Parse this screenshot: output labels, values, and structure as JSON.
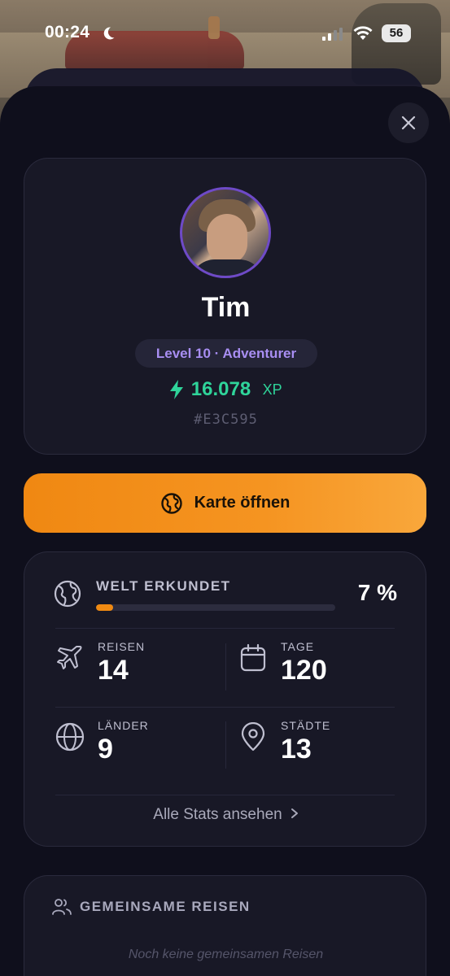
{
  "status_bar": {
    "time": "00:24",
    "battery": "56",
    "icons": [
      "moon-icon",
      "signal-icon",
      "wifi-icon",
      "battery-icon"
    ]
  },
  "profile": {
    "name": "Tim",
    "level_badge": "Level 10 · Adventurer",
    "xp_value": "16.078",
    "xp_unit": "XP",
    "code": "#E3C595"
  },
  "map_button": {
    "label": "Karte öffnen",
    "icon": "globe-icon"
  },
  "world_explored": {
    "label": "WELT ERKUNDET",
    "percent_text": "7 %",
    "progress": 0.07
  },
  "stats": [
    {
      "label": "REISEN",
      "value": "14",
      "icon": "airplane-icon"
    },
    {
      "label": "TAGE",
      "value": "120",
      "icon": "calendar-icon"
    },
    {
      "label": "LÄNDER",
      "value": "9",
      "icon": "globe-icon"
    },
    {
      "label": "STÄDTE",
      "value": "13",
      "icon": "map-pin-icon"
    }
  ],
  "all_stats_link": "Alle Stats ansehen",
  "shared_trips": {
    "title": "GEMEINSAME REISEN",
    "empty_text": "Noch keine gemeinsamen Reisen"
  },
  "colors": {
    "accent_orange": "#F08A12",
    "xp_green": "#2FD49A",
    "level_purple": "#A88EF2",
    "card_bg": "#181826",
    "sheet_bg": "#0F0F1C"
  }
}
